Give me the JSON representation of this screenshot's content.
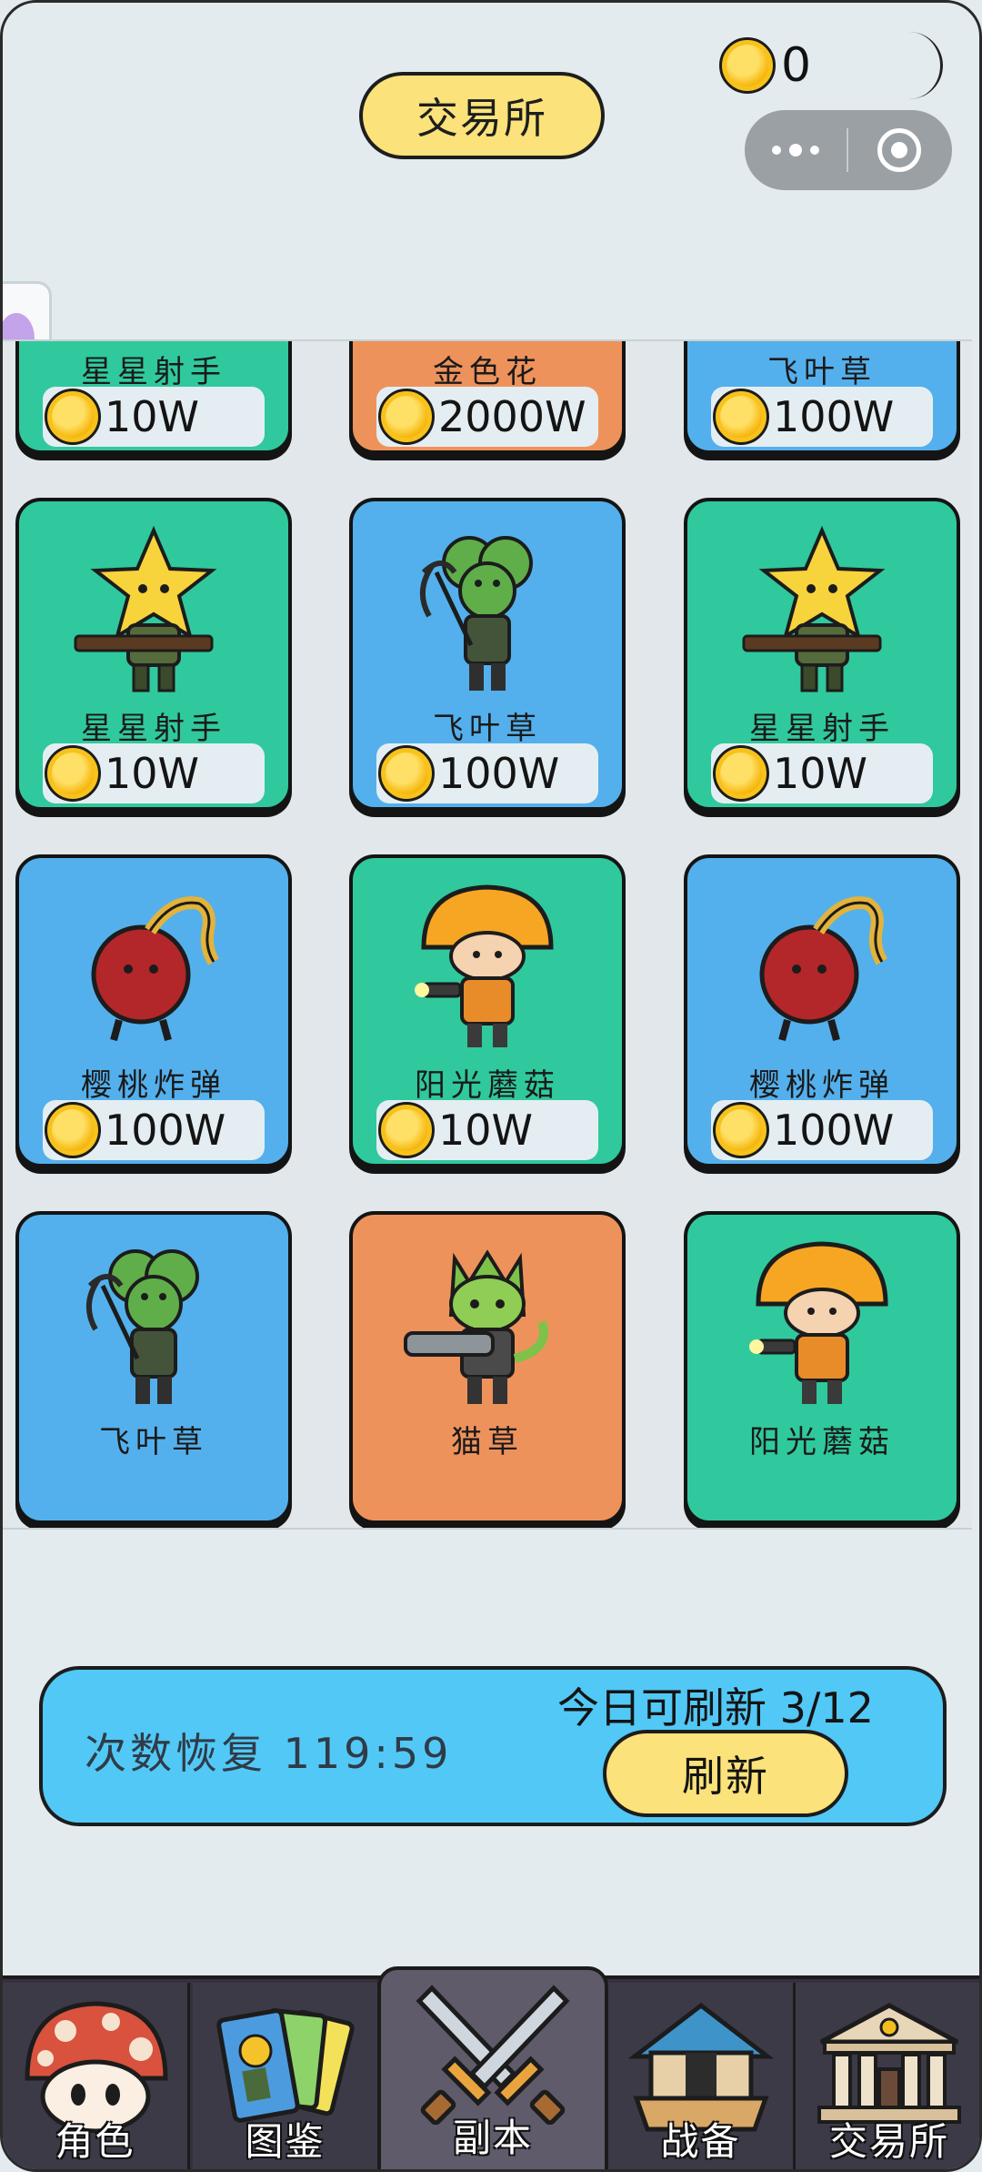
{
  "header": {
    "title": "交易所",
    "coin_balance": "0"
  },
  "grid": {
    "cards": [
      {
        "name": "星星射手",
        "price": "10W",
        "color": "#2fc99d",
        "art": "star-shooter"
      },
      {
        "name": "金色花",
        "price": "2000W",
        "color": "#ee925b",
        "art": "gold-flower"
      },
      {
        "name": "飞叶草",
        "price": "100W",
        "color": "#53b0ec",
        "art": "clover"
      },
      {
        "name": "星星射手",
        "price": "10W",
        "color": "#2fc99d",
        "art": "star-shooter"
      },
      {
        "name": "飞叶草",
        "price": "100W",
        "color": "#53b0ec",
        "art": "clover"
      },
      {
        "name": "星星射手",
        "price": "10W",
        "color": "#2fc99d",
        "art": "star-shooter"
      },
      {
        "name": "樱桃炸弹",
        "price": "100W",
        "color": "#53b0ec",
        "art": "cherry-bomb"
      },
      {
        "name": "阳光蘑菇",
        "price": "10W",
        "color": "#2fc99d",
        "art": "sun-mushroom"
      },
      {
        "name": "樱桃炸弹",
        "price": "100W",
        "color": "#53b0ec",
        "art": "cherry-bomb"
      },
      {
        "name": "飞叶草",
        "price": "",
        "color": "#53b0ec",
        "art": "clover"
      },
      {
        "name": "猫草",
        "price": "",
        "color": "#ee925b",
        "art": "cat-grass"
      },
      {
        "name": "阳光蘑菇",
        "price": "",
        "color": "#2fc99d",
        "art": "sun-mushroom"
      }
    ]
  },
  "refresh_panel": {
    "recover_label": "次数恢复 119:59",
    "today_label": "今日可刷新 3/12",
    "refresh_button": "刷新"
  },
  "tabbar": {
    "tabs": [
      {
        "label": "角色",
        "icon": "mushroom-icon"
      },
      {
        "label": "图鉴",
        "icon": "cards-icon"
      },
      {
        "label": "副本",
        "icon": "crossed-swords-icon",
        "active": true
      },
      {
        "label": "战备",
        "icon": "house-icon"
      },
      {
        "label": "交易所",
        "icon": "bank-icon"
      }
    ]
  },
  "colors": {
    "accent_yellow": "#fbe27a",
    "panel_blue": "#52c8f6",
    "card_green": "#2fc99d",
    "card_blue": "#53b0ec",
    "card_orange": "#ee925b",
    "tabbar_bg": "#34303d"
  }
}
